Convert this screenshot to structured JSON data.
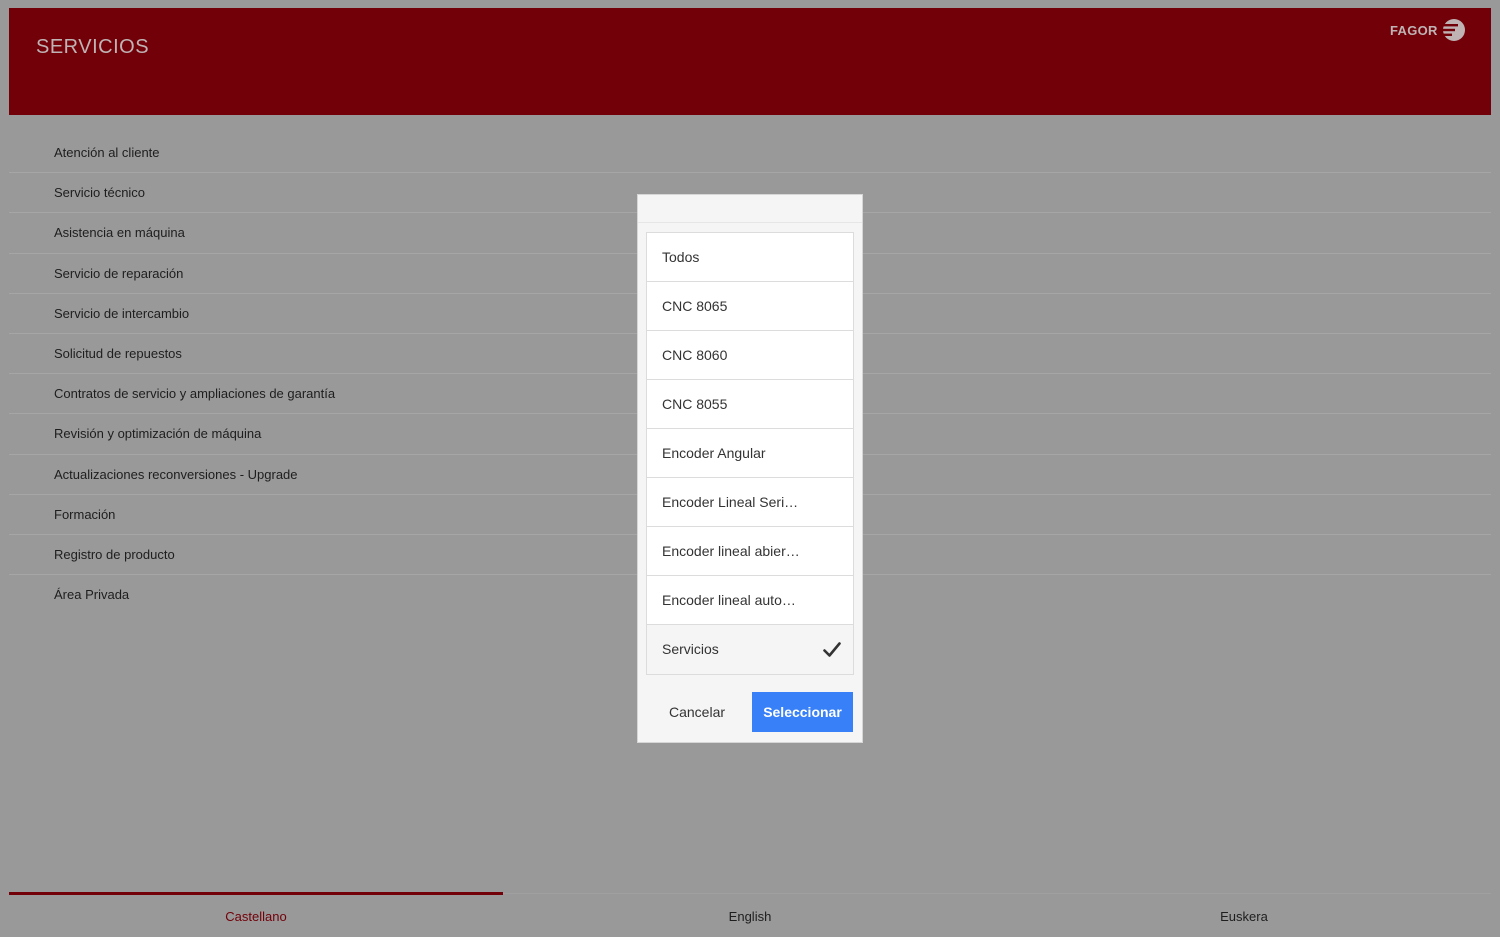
{
  "header": {
    "title": "SERVICIOS",
    "logo_text": "FAGOR"
  },
  "menu": {
    "items": [
      "Atención al cliente",
      "Servicio técnico",
      "Asistencia en máquina",
      "Servicio de reparación",
      "Servicio de intercambio",
      "Solicitud de repuestos",
      "Contratos de servicio y ampliaciones de garantía",
      "Revisión y optimización de máquina",
      "Actualizaciones reconversiones - Upgrade",
      "Formación",
      "Registro de producto",
      "Área Privada"
    ]
  },
  "dialog": {
    "options": [
      "Todos",
      "CNC 8065",
      "CNC 8060",
      "CNC 8055",
      "Encoder Angular",
      "Encoder Lineal Seri…",
      "Encoder lineal abier…",
      "Encoder lineal auto…",
      "Servicios"
    ],
    "selected_index": 8,
    "cancel_label": "Cancelar",
    "select_label": "Seleccionar"
  },
  "tabs": {
    "items": [
      "Castellano",
      "English",
      "Euskera"
    ],
    "active_index": 0
  },
  "colors": {
    "header_bg": "#720009",
    "overlay_bg": "#999999",
    "primary_button": "#3880f7",
    "active_tab": "#720009"
  },
  "icons": {
    "logo": "fagor-logo-icon",
    "selected": "check-icon"
  }
}
